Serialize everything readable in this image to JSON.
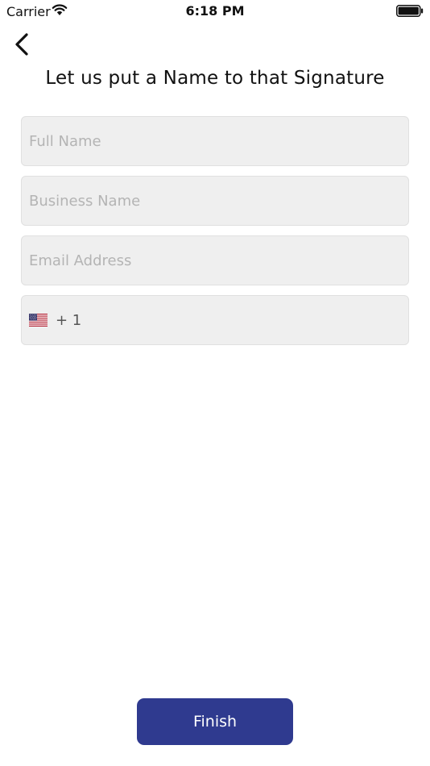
{
  "status_bar": {
    "carrier": "Carrier",
    "time": "6:18 PM"
  },
  "header": {
    "title": "Let us put a Name to that Signature"
  },
  "form": {
    "full_name": {
      "value": "",
      "placeholder": "Full Name"
    },
    "business_name": {
      "value": "",
      "placeholder": "Business Name"
    },
    "email": {
      "value": "",
      "placeholder": "Email Address"
    },
    "phone": {
      "country_icon": "us-flag-icon",
      "dial_code": "+ 1",
      "value": ""
    }
  },
  "actions": {
    "finish_label": "Finish"
  },
  "colors": {
    "accent": "#2f3a8f",
    "field_background": "#efefef",
    "placeholder": "#b4b4b4"
  }
}
